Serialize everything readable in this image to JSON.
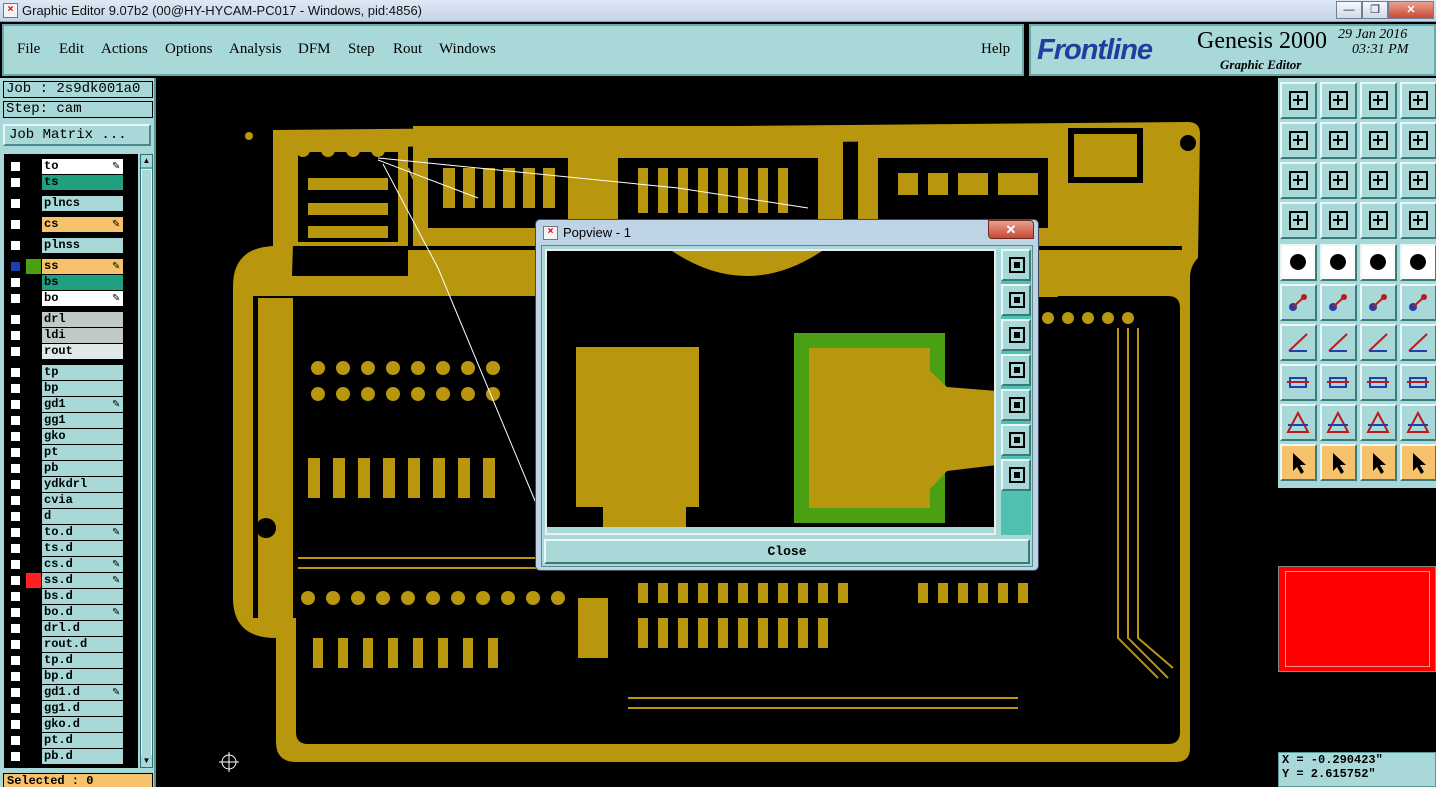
{
  "window": {
    "title": "Graphic Editor 9.07b2 (00@HY-HYCAM-PC017 - Windows, pid:4856)",
    "app_icon": "app-icon",
    "controls": [
      "minimize-icon",
      "restore-icon",
      "close-icon"
    ]
  },
  "menu": {
    "file": "File",
    "edit": "Edit",
    "actions": "Actions",
    "options": "Options",
    "analysis": "Analysis",
    "dfm": "DFM",
    "step": "Step",
    "rout": "Rout",
    "windows": "Windows",
    "help": "Help"
  },
  "brand": {
    "logo": "Frontline",
    "product": "Genesis 2000",
    "subtitle": "Graphic Editor",
    "date": "29 Jan 2016",
    "time": "03:31 PM"
  },
  "job": {
    "job_label": "Job : 2s9dk001a0",
    "step_label": "Step: cam",
    "matrix_button": "Job Matrix ..."
  },
  "layers": [
    {
      "name": "to",
      "color": "#ffffff",
      "editable": true
    },
    {
      "name": "ts",
      "color": "#20a080",
      "editable": false
    },
    {
      "name": "plncs",
      "color": "#a8d8d8",
      "editable": false
    },
    {
      "name": "cs",
      "color": "#f6c36c",
      "editable": true
    },
    {
      "name": "plnss",
      "color": "#a8d8d8",
      "editable": false
    },
    {
      "name": "ss",
      "color": "#f6c36c",
      "editable": true,
      "active": true
    },
    {
      "name": "bs",
      "color": "#20a080",
      "editable": false
    },
    {
      "name": "bo",
      "color": "#ffffff",
      "editable": true
    },
    {
      "name": "drl",
      "color": "#c0c8c8",
      "editable": false
    },
    {
      "name": "ldi",
      "color": "#c0c8c8",
      "editable": false
    },
    {
      "name": "rout",
      "color": "#e0e8e8",
      "editable": false
    },
    {
      "name": "tp",
      "color": "#a8d8d8",
      "editable": false
    },
    {
      "name": "bp",
      "color": "#a8d8d8",
      "editable": false
    },
    {
      "name": "gd1",
      "color": "#a8d8d8",
      "editable": true
    },
    {
      "name": "gg1",
      "color": "#a8d8d8",
      "editable": false
    },
    {
      "name": "gko",
      "color": "#a8d8d8",
      "editable": false
    },
    {
      "name": "pt",
      "color": "#a8d8d8",
      "editable": false
    },
    {
      "name": "pb",
      "color": "#a8d8d8",
      "editable": false
    },
    {
      "name": "ydkdrl",
      "color": "#a8d8d8",
      "editable": false
    },
    {
      "name": "cvia",
      "color": "#a8d8d8",
      "editable": false
    },
    {
      "name": "d",
      "color": "#a8d8d8",
      "editable": false
    },
    {
      "name": "to.d",
      "color": "#a8d8d8",
      "editable": true
    },
    {
      "name": "ts.d",
      "color": "#a8d8d8",
      "editable": false
    },
    {
      "name": "cs.d",
      "color": "#a8d8d8",
      "editable": true
    },
    {
      "name": "ss.d",
      "color": "#a8d8d8",
      "editable": true,
      "marker": "#ff2020"
    },
    {
      "name": "bs.d",
      "color": "#a8d8d8",
      "editable": false
    },
    {
      "name": "bo.d",
      "color": "#a8d8d8",
      "editable": true
    },
    {
      "name": "drl.d",
      "color": "#a8d8d8",
      "editable": false
    },
    {
      "name": "rout.d",
      "color": "#a8d8d8",
      "editable": false
    },
    {
      "name": "tp.d",
      "color": "#a8d8d8",
      "editable": false
    },
    {
      "name": "bp.d",
      "color": "#a8d8d8",
      "editable": false
    },
    {
      "name": "gd1.d",
      "color": "#a8d8d8",
      "editable": true
    },
    {
      "name": "gg1.d",
      "color": "#a8d8d8",
      "editable": false
    },
    {
      "name": "gko.d",
      "color": "#a8d8d8",
      "editable": false
    },
    {
      "name": "pt.d",
      "color": "#a8d8d8",
      "editable": false
    },
    {
      "name": "pb.d",
      "color": "#a8d8d8",
      "editable": false
    }
  ],
  "status": {
    "selected": "Selected : 0",
    "x": "X = -0.290423\"",
    "y": "Y = 2.615752\""
  },
  "popup": {
    "title": "Popview - 1",
    "close_label": "Close",
    "side_buttons": [
      "zoom-home-icon",
      "pan-up-icon",
      "pan-down-icon",
      "pan-left-icon",
      "pan-right-icon",
      "zoom-in-icon",
      "zoom-out-icon"
    ]
  },
  "colors": {
    "copper": "#b8960e",
    "solder_mask": "#4aa012",
    "panel": "#a8d8d8",
    "minimap": "#ff0000"
  },
  "toolbar_icons": [
    "zoom-home-icon",
    "zoom-fit-icon",
    "zoom-house-icon",
    "zoom-window-icon",
    "pan-left-icon",
    "pan-right-icon",
    "flip-view-icon",
    "snap-icon",
    "zoom-in-icon",
    "zoom-out-icon",
    "scale-1-2-icon",
    "help-icon",
    "measure-tool-icon",
    "grid-icon",
    "layer-toggle-icon",
    "layer-toggle-red-icon",
    "pad-snap-icon",
    "line-color-icon",
    "ruler-icon",
    "circle-snap-icon",
    "connect-icon",
    "cross-snap-icon",
    "line-point-icon",
    "line-point-red-icon",
    "angle-icon",
    "diagonal-line-icon",
    "rotate-icon",
    "mirror-icon",
    "add-pad-icon",
    "slot-icon",
    "pad-center-icon",
    "pad-group-icon",
    "arc-cw-icon",
    "arc-ccw-icon",
    "arc-up-icon",
    "arc-down-icon",
    "select-icon",
    "select-box-icon",
    "select-circle-icon",
    "select-net-icon"
  ]
}
